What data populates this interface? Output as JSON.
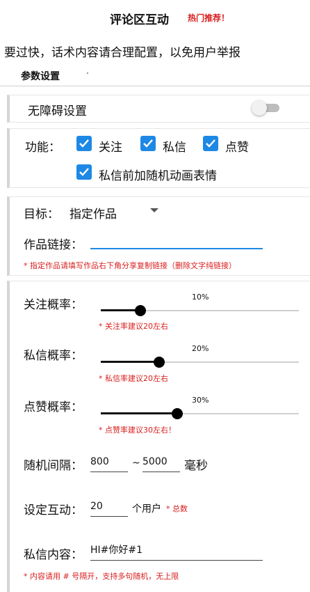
{
  "header": {
    "title": "评论区互动",
    "badge": "热门推荐！"
  },
  "notice": "要过快，话术内容请合理配置，以免用户举报",
  "section_title": "参数设置",
  "accessibility": {
    "label": "无障碍设置",
    "enabled": false
  },
  "features": {
    "label": "功能：",
    "follow": {
      "label": "关注",
      "checked": true
    },
    "message": {
      "label": "私信",
      "checked": true
    },
    "like": {
      "label": "点赞",
      "checked": true
    },
    "emoji": {
      "label": "私信前加随机动画表情",
      "checked": true
    }
  },
  "target": {
    "label": "目标：",
    "value": "指定作品",
    "link_label": "作品链接：",
    "link_value": "",
    "hint": "* 指定作品请填写作品右下角分享复制链接（删除文字纯链接）"
  },
  "rates": {
    "follow": {
      "label": "关注概率：",
      "value": 10,
      "display": "10%",
      "hint": "* 关注率建议20左右"
    },
    "message": {
      "label": "私信概率：",
      "value": 20,
      "display": "20%",
      "hint": "* 私信率建议20左右"
    },
    "like": {
      "label": "点赞概率：",
      "value": 30,
      "display": "30%",
      "hint": "* 点赞率建议30左右！"
    }
  },
  "interval": {
    "label": "随机间隔：",
    "min": "800",
    "sep": "~",
    "max": "5000",
    "unit": "毫秒"
  },
  "interaction": {
    "label": "设定互动：",
    "value": "20",
    "unit": "个用户",
    "note": "* 总数"
  },
  "message_content": {
    "label": "私信内容：",
    "value": "HI#你好#1",
    "hint": "* 内容请用 # 号隔开，支持多句随机，无上限"
  },
  "colors": {
    "accent": "#1e88e5",
    "warning": "#d81e1e"
  }
}
